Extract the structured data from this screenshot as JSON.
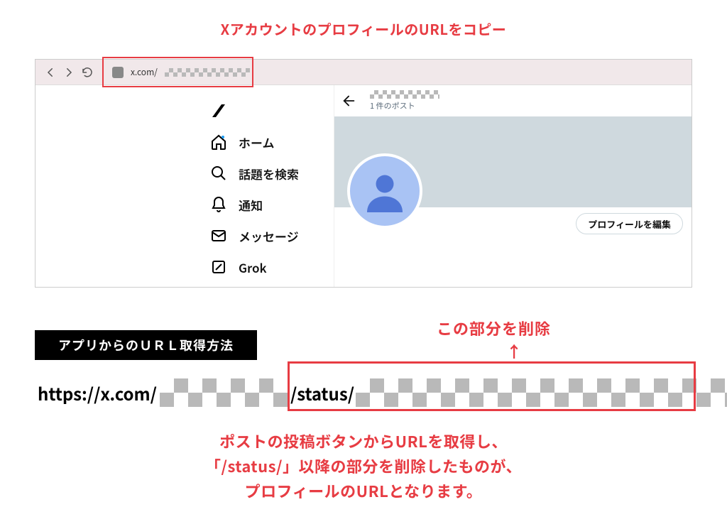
{
  "colors": {
    "accent_red": "#e73c43"
  },
  "annotations": {
    "top": "XアカウントのプロフィールのURLをコピー",
    "delete_label": "この部分を削除",
    "arrow": "↑",
    "bottom_l1": "ポストの投稿ボタンからURLを取得し、",
    "bottom_l2": "「/status/」以降の部分を削除したものが、",
    "bottom_l3": "プロフィールのURLとなります。"
  },
  "browser": {
    "toolbar": {
      "back_icon": "chevron-left",
      "forward_icon": "chevron-right",
      "reload_icon": "reload",
      "site_icon": "site-settings",
      "url_visible": "x.com/"
    },
    "nav": {
      "items": [
        {
          "icon": "x-logo",
          "label": ""
        },
        {
          "icon": "home-icon",
          "label": "ホーム"
        },
        {
          "icon": "search-icon",
          "label": "話題を検索"
        },
        {
          "icon": "bell-icon",
          "label": "通知"
        },
        {
          "icon": "mail-icon",
          "label": "メッセージ"
        },
        {
          "icon": "grok-icon",
          "label": "Grok"
        }
      ]
    },
    "profile": {
      "back_icon": "arrow-left",
      "post_count": "1 件のポスト",
      "edit_button": "プロフィールを編集"
    }
  },
  "lower": {
    "blackbar": "アプリからのＵＲＬ取得方法",
    "url_row": {
      "part1": "https://x.com/",
      "part2": "/status/"
    }
  }
}
